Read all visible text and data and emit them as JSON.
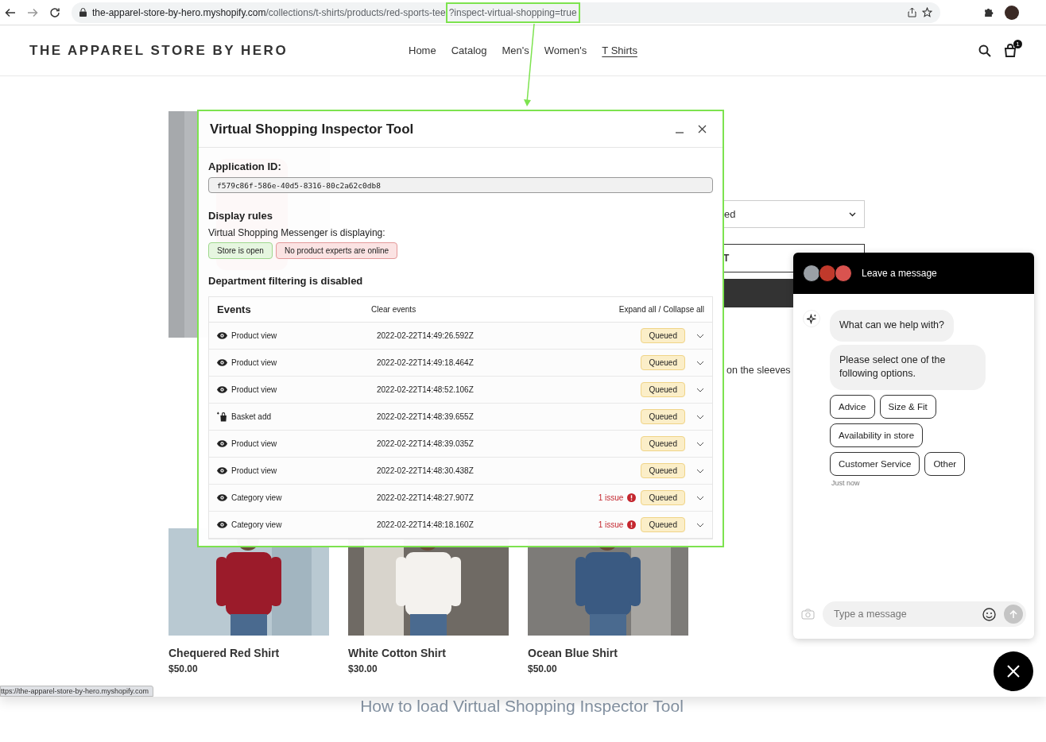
{
  "browser": {
    "url_host": "the-apparel-store-by-hero.myshopify.com",
    "url_path": "/collections/t-shirts/products/red-sports-tee",
    "url_highlight": "?inspect-virtual-shopping=true"
  },
  "store": {
    "logo": "THE APPAREL STORE BY HERO",
    "nav": [
      {
        "label": "Home",
        "selected": false
      },
      {
        "label": "Catalog",
        "selected": false
      },
      {
        "label": "Men's",
        "selected": false
      },
      {
        "label": "Women's",
        "selected": false
      },
      {
        "label": "T Shirts",
        "selected": true
      }
    ],
    "cart_count": "1"
  },
  "product": {
    "variant_select": "ed",
    "add_to_cart": "T",
    "description": "on the sleeves"
  },
  "related": [
    {
      "title": "Chequered Red Shirt",
      "price": "$50.00",
      "kind": "picture"
    },
    {
      "title": "White Cotton Shirt",
      "price": "$30.00",
      "kind": "picture"
    },
    {
      "title": "Ocean Blue Shirt",
      "price": "$50.00",
      "kind": "picture"
    }
  ],
  "status_url": "ttps://the-apparel-store-by-hero.myshopify.com",
  "inspector": {
    "title": "Virtual Shopping Inspector Tool",
    "app_id_label": "Application ID:",
    "app_id": "f579c86f-586e-40d5-8316-80c2a62c0db8",
    "display_rules_title": "Display rules",
    "display_rules_text": "Virtual Shopping Messenger is displaying:",
    "rules": [
      {
        "label": "Store is open",
        "kind": "positive"
      },
      {
        "label": "No product experts are online",
        "kind": "negative"
      }
    ],
    "department_text": "Department filtering is disabled",
    "events_title": "Events",
    "clear_events": "Clear events",
    "expand_all": "Expand all",
    "separator": "/",
    "collapse_all": "Collapse all",
    "events": [
      {
        "kind": "view",
        "label": "Product view",
        "time": "2022-02-22T14:49:26.592Z",
        "status": "Queued",
        "expanded": false
      },
      {
        "kind": "view",
        "label": "Product view",
        "time": "2022-02-22T14:49:18.464Z",
        "status": "Queued",
        "expanded": false
      },
      {
        "kind": "view",
        "label": "Product view",
        "time": "2022-02-22T14:48:52.106Z",
        "status": "Queued",
        "expanded": false
      },
      {
        "kind": "basket",
        "label": "Basket add",
        "time": "2022-02-22T14:48:39.655Z",
        "status": "Queued",
        "expanded": false
      },
      {
        "kind": "view",
        "label": "Product view",
        "time": "2022-02-22T14:48:39.035Z",
        "status": "Queued",
        "expanded": false
      },
      {
        "kind": "view",
        "label": "Product view",
        "time": "2022-02-22T14:48:30.438Z",
        "status": "Queued",
        "expanded": false
      },
      {
        "kind": "view",
        "label": "Category view",
        "time": "2022-02-22T14:48:27.907Z",
        "issue": "1 issue",
        "status": "Queued",
        "expanded": false
      },
      {
        "kind": "view",
        "label": "Category view",
        "time": "2022-02-22T14:48:18.160Z",
        "issue": "1 issue",
        "status": "Queued",
        "expanded": false
      }
    ]
  },
  "chat": {
    "header": "Leave a message",
    "avatars": [
      {
        "color": "#9aa0a6"
      },
      {
        "color": "#c0392b"
      },
      {
        "color": "#d9534f"
      }
    ],
    "messages": [
      "What can we help with?",
      "Please select one of the following options."
    ],
    "options": [
      [
        "Advice",
        "Size & Fit"
      ],
      [
        "Availability in store"
      ],
      [
        "Customer Service",
        "Other"
      ]
    ],
    "timestamp": "Just now",
    "input_placeholder": "Type a message"
  },
  "caption": "How to load Virtual Shopping Inspector Tool"
}
